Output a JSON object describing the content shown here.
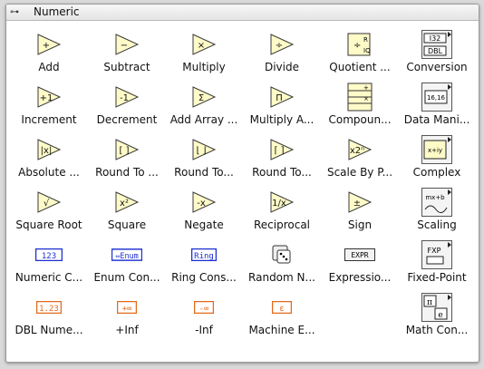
{
  "window": {
    "title": "Numeric",
    "pin_glyph": "⊶"
  },
  "colors": {
    "tri_fill": "#fffbc8",
    "tri_stroke": "#3a3a3a",
    "const_blue": "#1b2fd1",
    "const_orange": "#e46a1b"
  },
  "palette": {
    "rows": [
      [
        {
          "label": "Add",
          "icon": "add-icon",
          "glyph": "+"
        },
        {
          "label": "Subtract",
          "icon": "subtract-icon",
          "glyph": "−"
        },
        {
          "label": "Multiply",
          "icon": "multiply-icon",
          "glyph": "×"
        },
        {
          "label": "Divide",
          "icon": "divide-icon",
          "glyph": "÷"
        },
        {
          "label": "Quotient ...",
          "icon": "quotient-remainder-icon",
          "glyph": "÷R IQ"
        },
        {
          "label": "Conversion",
          "icon": "conversion-subpalette-icon",
          "glyph": "I32 DBL"
        }
      ],
      [
        {
          "label": "Increment",
          "icon": "increment-icon",
          "glyph": "+1"
        },
        {
          "label": "Decrement",
          "icon": "decrement-icon",
          "glyph": "-1"
        },
        {
          "label": "Add Array ...",
          "icon": "add-array-elements-icon",
          "glyph": "Σ"
        },
        {
          "label": "Multiply A...",
          "icon": "multiply-array-elements-icon",
          "glyph": "Π"
        },
        {
          "label": "Compoun...",
          "icon": "compound-arithmetic-icon",
          "glyph": "+×"
        },
        {
          "label": "Data Mani...",
          "icon": "data-manipulation-subpalette-icon",
          "glyph": "16,16"
        }
      ],
      [
        {
          "label": "Absolute ...",
          "icon": "absolute-value-icon",
          "glyph": "|x|"
        },
        {
          "label": "Round To ...",
          "icon": "round-to-nearest-icon",
          "glyph": "[ ]"
        },
        {
          "label": "Round To...",
          "icon": "round-toward-minus-inf-icon",
          "glyph": "⌊ ⌋"
        },
        {
          "label": "Round To...",
          "icon": "round-toward-plus-inf-icon",
          "glyph": "⌈ ⌉"
        },
        {
          "label": "Scale By P...",
          "icon": "scale-by-power-of-2-icon",
          "glyph": "x2ⁿ"
        },
        {
          "label": "Complex",
          "icon": "complex-subpalette-icon",
          "glyph": "x+iy"
        }
      ],
      [
        {
          "label": "Square Root",
          "icon": "square-root-icon",
          "glyph": "√"
        },
        {
          "label": "Square",
          "icon": "square-icon",
          "glyph": "x²"
        },
        {
          "label": "Negate",
          "icon": "negate-icon",
          "glyph": "-x"
        },
        {
          "label": "Reciprocal",
          "icon": "reciprocal-icon",
          "glyph": "1/x"
        },
        {
          "label": "Sign",
          "icon": "sign-icon",
          "glyph": "±"
        },
        {
          "label": "Scaling",
          "icon": "scaling-subpalette-icon",
          "glyph": "mx+b"
        }
      ],
      [
        {
          "label": "Numeric C...",
          "icon": "numeric-constant-icon",
          "glyph": "123"
        },
        {
          "label": "Enum Con...",
          "icon": "enum-constant-icon",
          "glyph": "Enum"
        },
        {
          "label": "Ring Cons...",
          "icon": "ring-constant-icon",
          "glyph": "Ring"
        },
        {
          "label": "Random N...",
          "icon": "random-number-dice-icon",
          "glyph": "⚄"
        },
        {
          "label": "Expressio...",
          "icon": "expression-node-icon",
          "glyph": "EXPR"
        },
        {
          "label": "Fixed-Point",
          "icon": "fixed-point-subpalette-icon",
          "glyph": "FXP"
        }
      ],
      [
        {
          "label": "DBL Nume...",
          "icon": "dbl-numeric-constant-icon",
          "glyph": "1.23"
        },
        {
          "label": "+Inf",
          "icon": "plus-infinity-constant-icon",
          "glyph": "+∞"
        },
        {
          "label": "-Inf",
          "icon": "minus-infinity-constant-icon",
          "glyph": "-∞"
        },
        {
          "label": "Machine E...",
          "icon": "machine-epsilon-icon",
          "glyph": "ε"
        },
        null,
        {
          "label": "Math Con...",
          "icon": "math-constants-subpalette-icon",
          "glyph": "π e"
        }
      ]
    ]
  }
}
